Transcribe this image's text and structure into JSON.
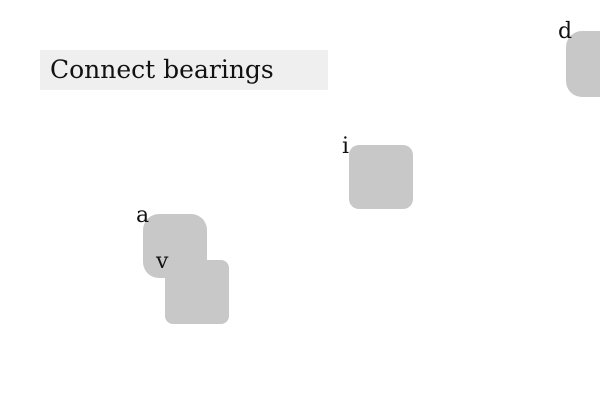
{
  "header": {
    "title": "Connect bearings"
  },
  "nodes": [
    {
      "id": "a",
      "label": "a"
    },
    {
      "id": "v",
      "label": "v"
    },
    {
      "id": "i",
      "label": "i"
    },
    {
      "id": "d",
      "label": "d"
    }
  ],
  "colors": {
    "background": "#ffffff",
    "title_bar": "#efefef",
    "node_fill": "#c8c8c8",
    "text": "#111111"
  }
}
